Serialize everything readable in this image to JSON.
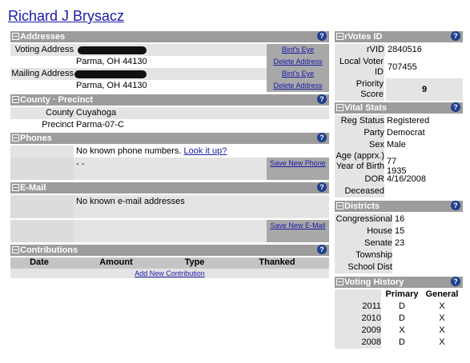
{
  "person": {
    "name": "Richard J Brysacz"
  },
  "addresses": {
    "title": "Addresses",
    "voting_label": "Voting Address",
    "voting_city": "Parma, OH 44130",
    "mailing_label": "Mailing Address",
    "mailing_city": "Parma, OH 44130",
    "birds_eye": "Bird's Eye",
    "delete": "Delete Address"
  },
  "county": {
    "title": "County · Precinct",
    "county_label": "County",
    "county_value": "Cuyahoga",
    "precinct_label": "Precinct",
    "precinct_value": "Parma-07-C"
  },
  "phones": {
    "title": "Phones",
    "none_text": "No known phone numbers.",
    "lookup": "Look it up?",
    "dashes": "- -",
    "save": "Save New Phone"
  },
  "email": {
    "title": "E-Mail",
    "none_text": "No known e-mail addresses",
    "save": "Save New E-Mail"
  },
  "contributions": {
    "title": "Contributions",
    "columns": [
      "Date",
      "Amount",
      "Type",
      "Thanked"
    ],
    "add": "Add New Contribution"
  },
  "rvotes": {
    "title": "rVotes ID",
    "rvid_label": "rVID",
    "rvid": "2840516",
    "local_label": "Local Voter ID",
    "local_id": "707455",
    "priority_label": "Priority Score",
    "priority": "9"
  },
  "vital": {
    "title": "Vital Stats",
    "rows": [
      {
        "label": "Reg Status",
        "value": "Registered"
      },
      {
        "label": "Party",
        "value": "Democrat"
      },
      {
        "label": "Sex",
        "value": "Male"
      },
      {
        "label": "Age (apprx.)",
        "value": "77"
      },
      {
        "label": "Year of Birth",
        "value": "1935"
      },
      {
        "label": "DOR",
        "value": "4/16/2008"
      },
      {
        "label": "Deceased",
        "value": ""
      }
    ]
  },
  "districts": {
    "title": "Districts",
    "rows": [
      {
        "label": "Congressional",
        "value": "16"
      },
      {
        "label": "House",
        "value": "15"
      },
      {
        "label": "Senate",
        "value": "23"
      },
      {
        "label": "Township",
        "value": ""
      },
      {
        "label": "School Dist",
        "value": ""
      }
    ]
  },
  "history": {
    "title": "Voting History",
    "columns": [
      "Primary",
      "General"
    ],
    "rows": [
      {
        "year": "2011",
        "primary": "D",
        "general": "X"
      },
      {
        "year": "2010",
        "primary": "D",
        "general": "X"
      },
      {
        "year": "2009",
        "primary": "X",
        "general": "X"
      },
      {
        "year": "2008",
        "primary": "D",
        "general": "X"
      }
    ]
  },
  "help_glyph": "?"
}
